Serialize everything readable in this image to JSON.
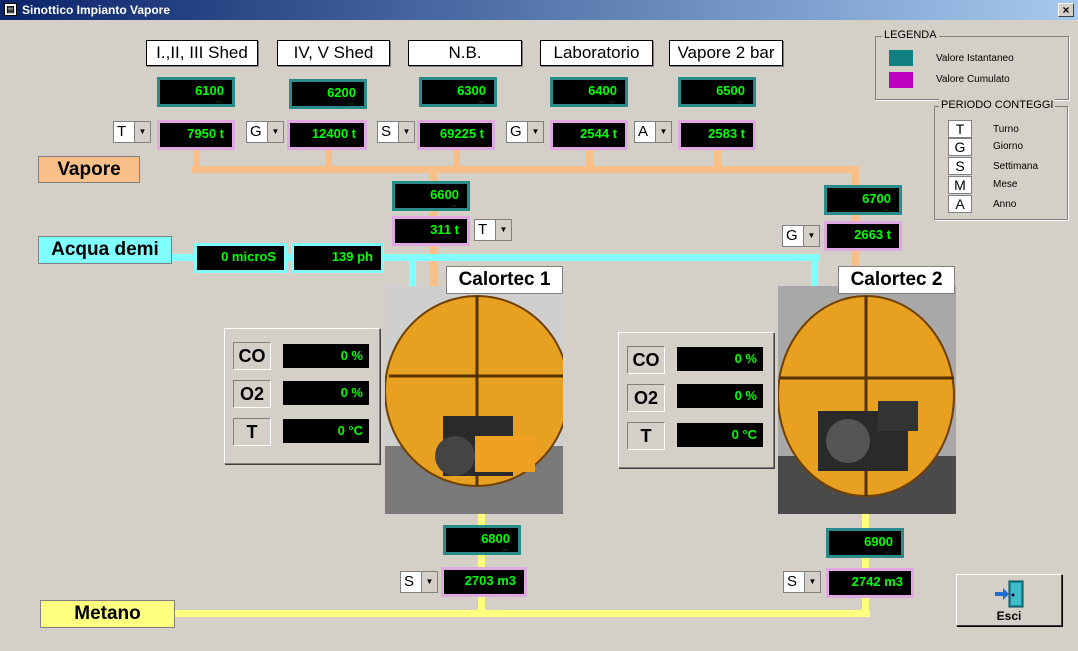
{
  "window": {
    "title": "Sinottico Impianto Vapore",
    "close": "×"
  },
  "colors": {
    "steam": "#f8c088",
    "water": "#80ffff",
    "gas": "#ffff80",
    "instant": "#108080",
    "cumulative": "#c000c0"
  },
  "consumers": [
    {
      "label": "I.,II, III Shed",
      "meter": "6100",
      "period": "T",
      "value": "7950 t"
    },
    {
      "label": "IV, V Shed",
      "meter": "6200",
      "period": "G",
      "value": "12400 t"
    },
    {
      "label": "N.B.",
      "meter": "6300",
      "period": "S",
      "value": "69225 t"
    },
    {
      "label": "Laboratorio",
      "meter": "6400",
      "period": "G",
      "value": "2544 t"
    },
    {
      "label": "Vapore 2 bar",
      "meter": "6500",
      "period": "A",
      "value": "2583 t"
    }
  ],
  "lines": {
    "steam": "Vapore",
    "water": "Acqua demi",
    "gas": "Metano"
  },
  "water": {
    "conductivity": "0 microS",
    "ph": "139 ph"
  },
  "boilers": [
    {
      "name": "Calortec 1",
      "steam_meter": "6600",
      "steam_period": "T",
      "steam_value": "311 t",
      "gas_meter": "6800",
      "gas_period": "S",
      "gas_value": "2703 m3",
      "co_label": "CO",
      "co": "0 %",
      "o2_label": "O2",
      "o2": "0 %",
      "t_label": "T",
      "t": "0 °C"
    },
    {
      "name": "Calortec 2",
      "steam_meter": "6700",
      "steam_period": "G",
      "steam_value": "2663 t",
      "gas_meter": "6900",
      "gas_period": "S",
      "gas_value": "2742 m3",
      "co_label": "CO",
      "co": "0 %",
      "o2_label": "O2",
      "o2": "0 %",
      "t_label": "T",
      "t": "0 °C"
    }
  ],
  "legend": {
    "title": "LEGENDA",
    "instant": "Valore Istantaneo",
    "cumulative": "Valore Cumulato"
  },
  "periods": {
    "title": "PERIODO CONTEGGI",
    "items": [
      {
        "code": "T",
        "label": "Turno"
      },
      {
        "code": "G",
        "label": "Giorno"
      },
      {
        "code": "S",
        "label": "Settimana"
      },
      {
        "code": "M",
        "label": "Mese"
      },
      {
        "code": "A",
        "label": "Anno"
      }
    ]
  },
  "exit": {
    "label": "Esci",
    "icon": "exit-door-icon"
  }
}
